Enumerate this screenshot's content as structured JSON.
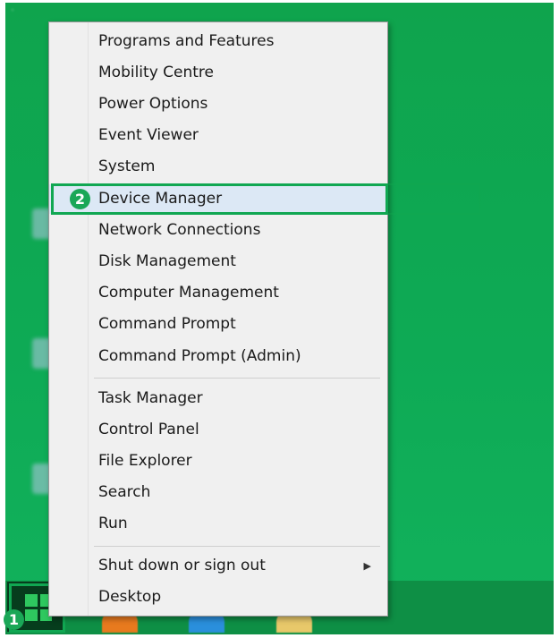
{
  "menu": {
    "items": [
      {
        "label": "Programs and Features"
      },
      {
        "label": "Mobility Centre"
      },
      {
        "label": "Power Options"
      },
      {
        "label": "Event Viewer"
      },
      {
        "label": "System"
      },
      {
        "label": "Device Manager",
        "selected": true
      },
      {
        "label": "Network Connections"
      },
      {
        "label": "Disk Management"
      },
      {
        "label": "Computer Management"
      },
      {
        "label": "Command Prompt"
      },
      {
        "label": "Command Prompt (Admin)"
      },
      {
        "label": "Task Manager"
      },
      {
        "label": "Control Panel"
      },
      {
        "label": "File Explorer"
      },
      {
        "label": "Search"
      },
      {
        "label": "Run"
      },
      {
        "label": "Shut down or sign out",
        "submenu_icon": "chevron-right-icon"
      },
      {
        "label": "Desktop"
      }
    ]
  },
  "annotations": {
    "step1": "1",
    "step2": "2"
  },
  "colors": {
    "desktop": "#0fa44d",
    "highlight": "#10a752",
    "menu_bg": "#f0f0f0",
    "selected_bg": "#dce8f5"
  },
  "start_button": {
    "icon": "windows-logo-icon"
  }
}
